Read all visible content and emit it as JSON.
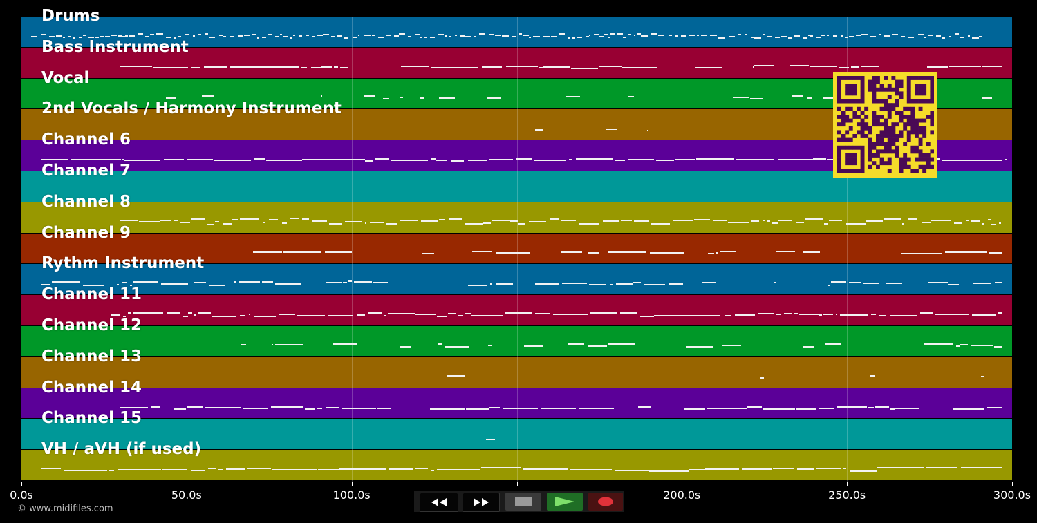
{
  "tracks": [
    {
      "label": "Drums",
      "color": "#006598"
    },
    {
      "label": "Bass Instrument",
      "color": "#980033"
    },
    {
      "label": "Vocal",
      "color": "#009828"
    },
    {
      "label": "2nd Vocals / Harmony Instrument",
      "color": "#986500"
    },
    {
      "label": "Channel 6",
      "color": "#5b0098"
    },
    {
      "label": "Channel 7",
      "color": "#009898"
    },
    {
      "label": "Channel 8",
      "color": "#989800"
    },
    {
      "label": "Channel 9",
      "color": "#982800"
    },
    {
      "label": "Rythm Instrument",
      "color": "#006598"
    },
    {
      "label": "Channel 11",
      "color": "#980033"
    },
    {
      "label": "Channel 12",
      "color": "#009828"
    },
    {
      "label": "Channel 13",
      "color": "#986500"
    },
    {
      "label": "Channel 14",
      "color": "#5b0098"
    },
    {
      "label": "Channel 15",
      "color": "#009898"
    },
    {
      "label": "VH / aVH (if used)",
      "color": "#989800"
    }
  ],
  "axis": {
    "unit": "s",
    "range": [
      0,
      300
    ],
    "ticks": [
      "0.0s",
      "50.0s",
      "100.0s",
      "150.0s",
      "200.0s",
      "250.0s",
      "300.0s"
    ],
    "tick_values": [
      0,
      50,
      100,
      150,
      200,
      250,
      300
    ]
  },
  "copyright": "© www.midifiles.com",
  "transport": {
    "buttons": [
      {
        "name": "rewind-button",
        "icon": "rewind-icon"
      },
      {
        "name": "fast-forward-button",
        "icon": "fast-forward-icon"
      },
      {
        "name": "stop-button",
        "icon": "stop-icon"
      },
      {
        "name": "play-button",
        "icon": "play-icon"
      },
      {
        "name": "record-button",
        "icon": "record-icon"
      }
    ]
  },
  "qr_code": {
    "icon": "qr-code-icon",
    "background": "#f5dc2a",
    "foreground": "#4a0a55"
  }
}
